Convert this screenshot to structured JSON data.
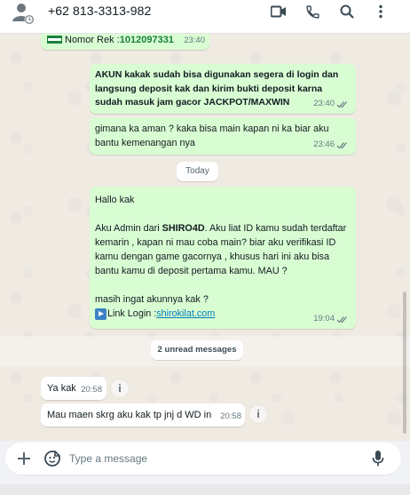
{
  "header": {
    "contact_name": "+62 813-3313-982",
    "icons": [
      "avatar-icon",
      "video-call-icon",
      "voice-call-icon",
      "search-icon",
      "menu-icon"
    ]
  },
  "messages": {
    "m0": {
      "label": "Nomor Rek",
      "sep": " :",
      "account": "1012097331",
      "time": "23:40"
    },
    "m1": {
      "text": "AKUN kakak sudah bisa digunakan segera di login dan langsung deposit kak dan kirim bukti deposit karna sudah masuk jam gacor JACKPOT/MAXWIN",
      "time": "23:40"
    },
    "m2": {
      "text": "gimana ka aman ? kaka bisa main kapan ni ka biar aku bantu kemenangan nya",
      "time": "23:46"
    },
    "date_separator": "Today",
    "m3": {
      "greeting": "Hallo kak",
      "line_a": "Aku Admin dari ",
      "brand": "SHIRO4D",
      "line_b": ". Aku liat ID kamu sudah terdaftar kemarin  , kapan ni mau coba main?  biar aku verifikasi ID kamu dengan game gacornya , khusus hari ini aku bisa bantu kamu di deposit pertama kamu. MAU ?",
      "ask": "masih ingat akunnya kak ?",
      "link_label": "Link Login : ",
      "link_url": "shirokilat.com",
      "time": "19:04"
    },
    "unread_label": "2 unread messages",
    "m4": {
      "text": "Ya kak",
      "time": "20:58"
    },
    "m5": {
      "text": "Mau maen skrg aku kak tp jnj d WD in",
      "time": "20:58"
    }
  },
  "composer": {
    "placeholder": "Type a message",
    "icons": [
      "plus-icon",
      "sticker-icon",
      "mic-icon"
    ]
  },
  "colors": {
    "outgoing_bubble": "#d9fdd3",
    "incoming_bubble": "#ffffff",
    "chat_background": "#efeae2",
    "link": "#027eb5",
    "flag_green": "#1a7f3c"
  }
}
